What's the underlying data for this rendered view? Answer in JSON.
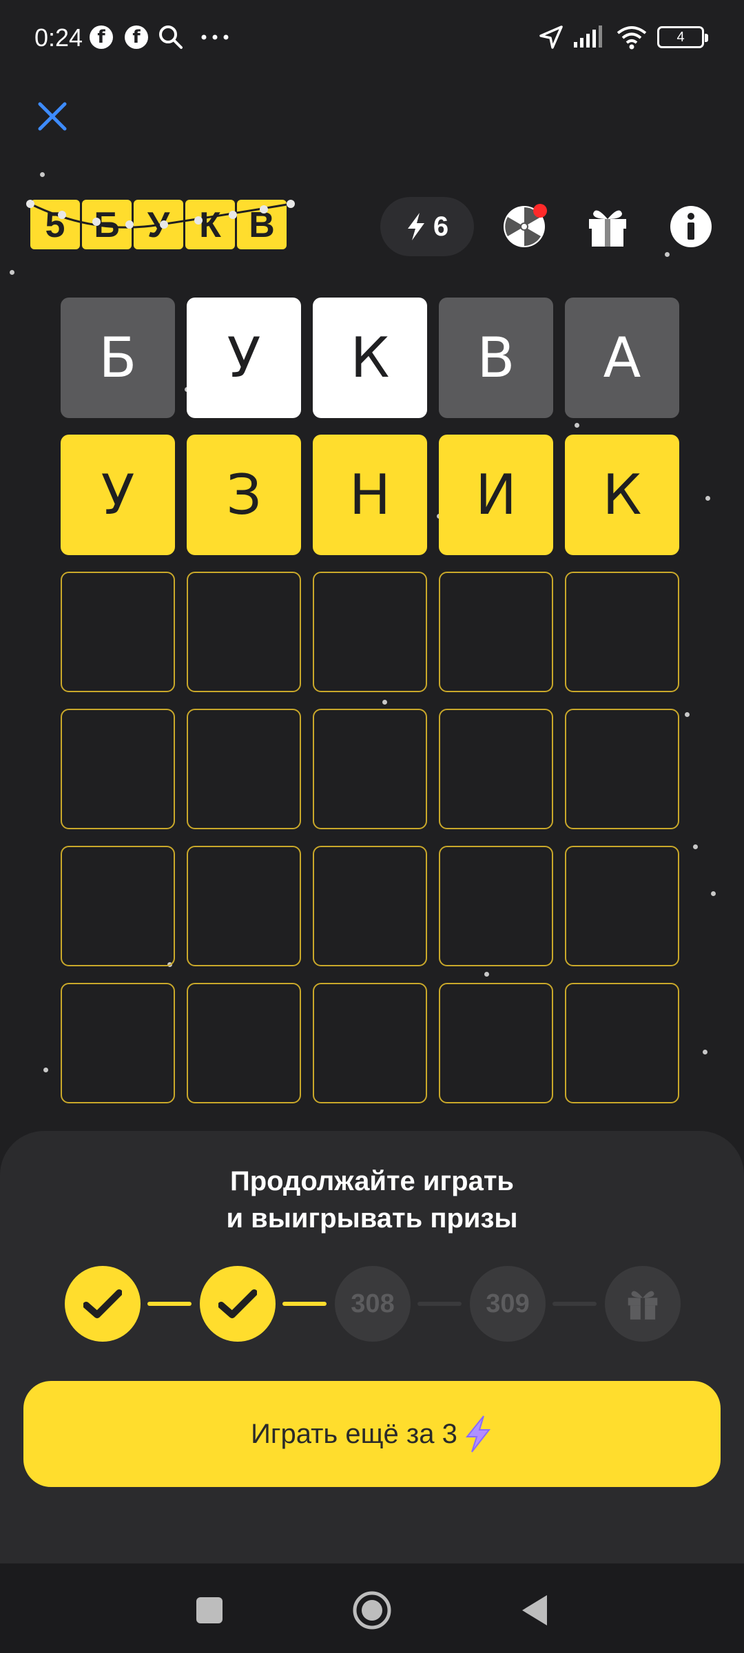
{
  "status_bar": {
    "time": "0:24",
    "battery": "4",
    "icons": [
      "facebook-icon",
      "facebook-icon",
      "search-icon",
      "more-icon",
      "location-icon",
      "signal-icon",
      "wifi-icon",
      "battery-icon"
    ]
  },
  "header": {
    "logo_letters": [
      "5",
      "Б",
      "У",
      "К",
      "В"
    ],
    "energy_count": "6",
    "icons": [
      "lightning-icon",
      "wheel-icon",
      "gift-icon",
      "info-icon"
    ],
    "notification_color": "#ff2a2a"
  },
  "board": {
    "rows": [
      [
        {
          "letter": "Б",
          "state": "absent"
        },
        {
          "letter": "У",
          "state": "present"
        },
        {
          "letter": "К",
          "state": "present"
        },
        {
          "letter": "В",
          "state": "absent"
        },
        {
          "letter": "А",
          "state": "absent"
        }
      ],
      [
        {
          "letter": "У",
          "state": "correct"
        },
        {
          "letter": "З",
          "state": "correct"
        },
        {
          "letter": "Н",
          "state": "correct"
        },
        {
          "letter": "И",
          "state": "correct"
        },
        {
          "letter": "К",
          "state": "correct"
        }
      ],
      [
        {
          "letter": "",
          "state": "empty"
        },
        {
          "letter": "",
          "state": "empty"
        },
        {
          "letter": "",
          "state": "empty"
        },
        {
          "letter": "",
          "state": "empty"
        },
        {
          "letter": "",
          "state": "empty"
        }
      ],
      [
        {
          "letter": "",
          "state": "empty"
        },
        {
          "letter": "",
          "state": "empty"
        },
        {
          "letter": "",
          "state": "empty"
        },
        {
          "letter": "",
          "state": "empty"
        },
        {
          "letter": "",
          "state": "empty"
        }
      ],
      [
        {
          "letter": "",
          "state": "empty"
        },
        {
          "letter": "",
          "state": "empty"
        },
        {
          "letter": "",
          "state": "empty"
        },
        {
          "letter": "",
          "state": "empty"
        },
        {
          "letter": "",
          "state": "empty"
        }
      ],
      [
        {
          "letter": "",
          "state": "empty"
        },
        {
          "letter": "",
          "state": "empty"
        },
        {
          "letter": "",
          "state": "empty"
        },
        {
          "letter": "",
          "state": "empty"
        },
        {
          "letter": "",
          "state": "empty"
        }
      ]
    ]
  },
  "sheet": {
    "title_line1": "Продолжайте играть",
    "title_line2": "и выигрывать призы",
    "steps": [
      {
        "label": "",
        "state": "done",
        "icon": "check-icon"
      },
      {
        "label": "",
        "state": "done",
        "icon": "check-icon"
      },
      {
        "label": "308",
        "state": "pending",
        "icon": ""
      },
      {
        "label": "309",
        "state": "pending",
        "icon": ""
      },
      {
        "label": "",
        "state": "pending",
        "icon": "gift-icon"
      }
    ],
    "play_button_label": "Играть ещё за 3"
  },
  "colors": {
    "accent": "#ffdd2d",
    "background": "#1f1f21",
    "absent": "#5a5a5c",
    "present": "#ffffff",
    "close": "#3d8bff"
  },
  "nav": {
    "icons": [
      "recent-apps-icon",
      "home-icon",
      "back-icon"
    ]
  }
}
